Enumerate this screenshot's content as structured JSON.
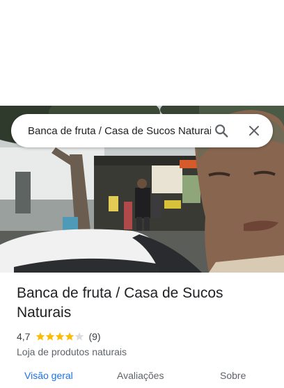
{
  "search": {
    "value": "Banca de fruta / Casa de Sucos Naturais",
    "search_icon": "search-icon",
    "close_icon": "close-icon"
  },
  "place": {
    "name": "Banca de fruta / Casa de Sucos Naturais",
    "rating": "4,7",
    "rating_value": 4.7,
    "review_count": "(9)",
    "category": "Loja de produtos naturais"
  },
  "tabs": [
    {
      "label": "Visão geral",
      "active": true
    },
    {
      "label": "Avaliações",
      "active": false
    },
    {
      "label": "Sobre",
      "active": false
    }
  ],
  "colors": {
    "accent": "#1a73e8",
    "star": "#fbbc04",
    "text": "#202124"
  }
}
